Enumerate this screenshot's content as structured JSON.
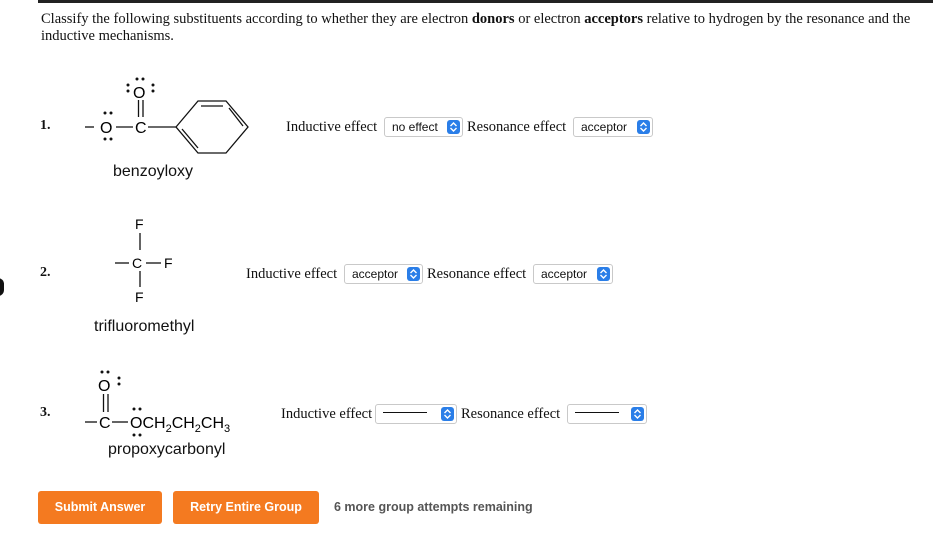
{
  "instructions": {
    "p1": "Classify the following substituents according to whether they are electron ",
    "donors": "donors",
    "p2": " or electron ",
    "acceptors": "acceptors",
    "p3": " relative to hydrogen by the resonance and the",
    "line2": "inductive mechanisms."
  },
  "items": [
    {
      "number": "1.",
      "name": "benzoyloxy",
      "inductive_label": "Inductive effect",
      "inductive_value": "no effect",
      "resonance_label": "Resonance effect",
      "resonance_value": "acceptor"
    },
    {
      "number": "2.",
      "name": "trifluoromethyl",
      "inductive_label": "Inductive effect",
      "inductive_value": "acceptor",
      "resonance_label": "Resonance effect",
      "resonance_value": "acceptor"
    },
    {
      "number": "3.",
      "name": "propoxycarbonyl",
      "inductive_label": "Inductive effect",
      "inductive_value": "",
      "resonance_label": "Resonance effect",
      "resonance_value": ""
    }
  ],
  "structures": {
    "o": "O",
    "c": "C",
    "f": "F",
    "chain": "OCH",
    "ch2": "CH",
    "ch3": "CH",
    "sub2": "2",
    "sub3": "3"
  },
  "buttons": {
    "submit": "Submit Answer",
    "retry": "Retry Entire Group"
  },
  "attempts_text": "6 more group attempts remaining",
  "colors": {
    "button": "#f47a20",
    "select_arrow": "#2a7ee8"
  }
}
